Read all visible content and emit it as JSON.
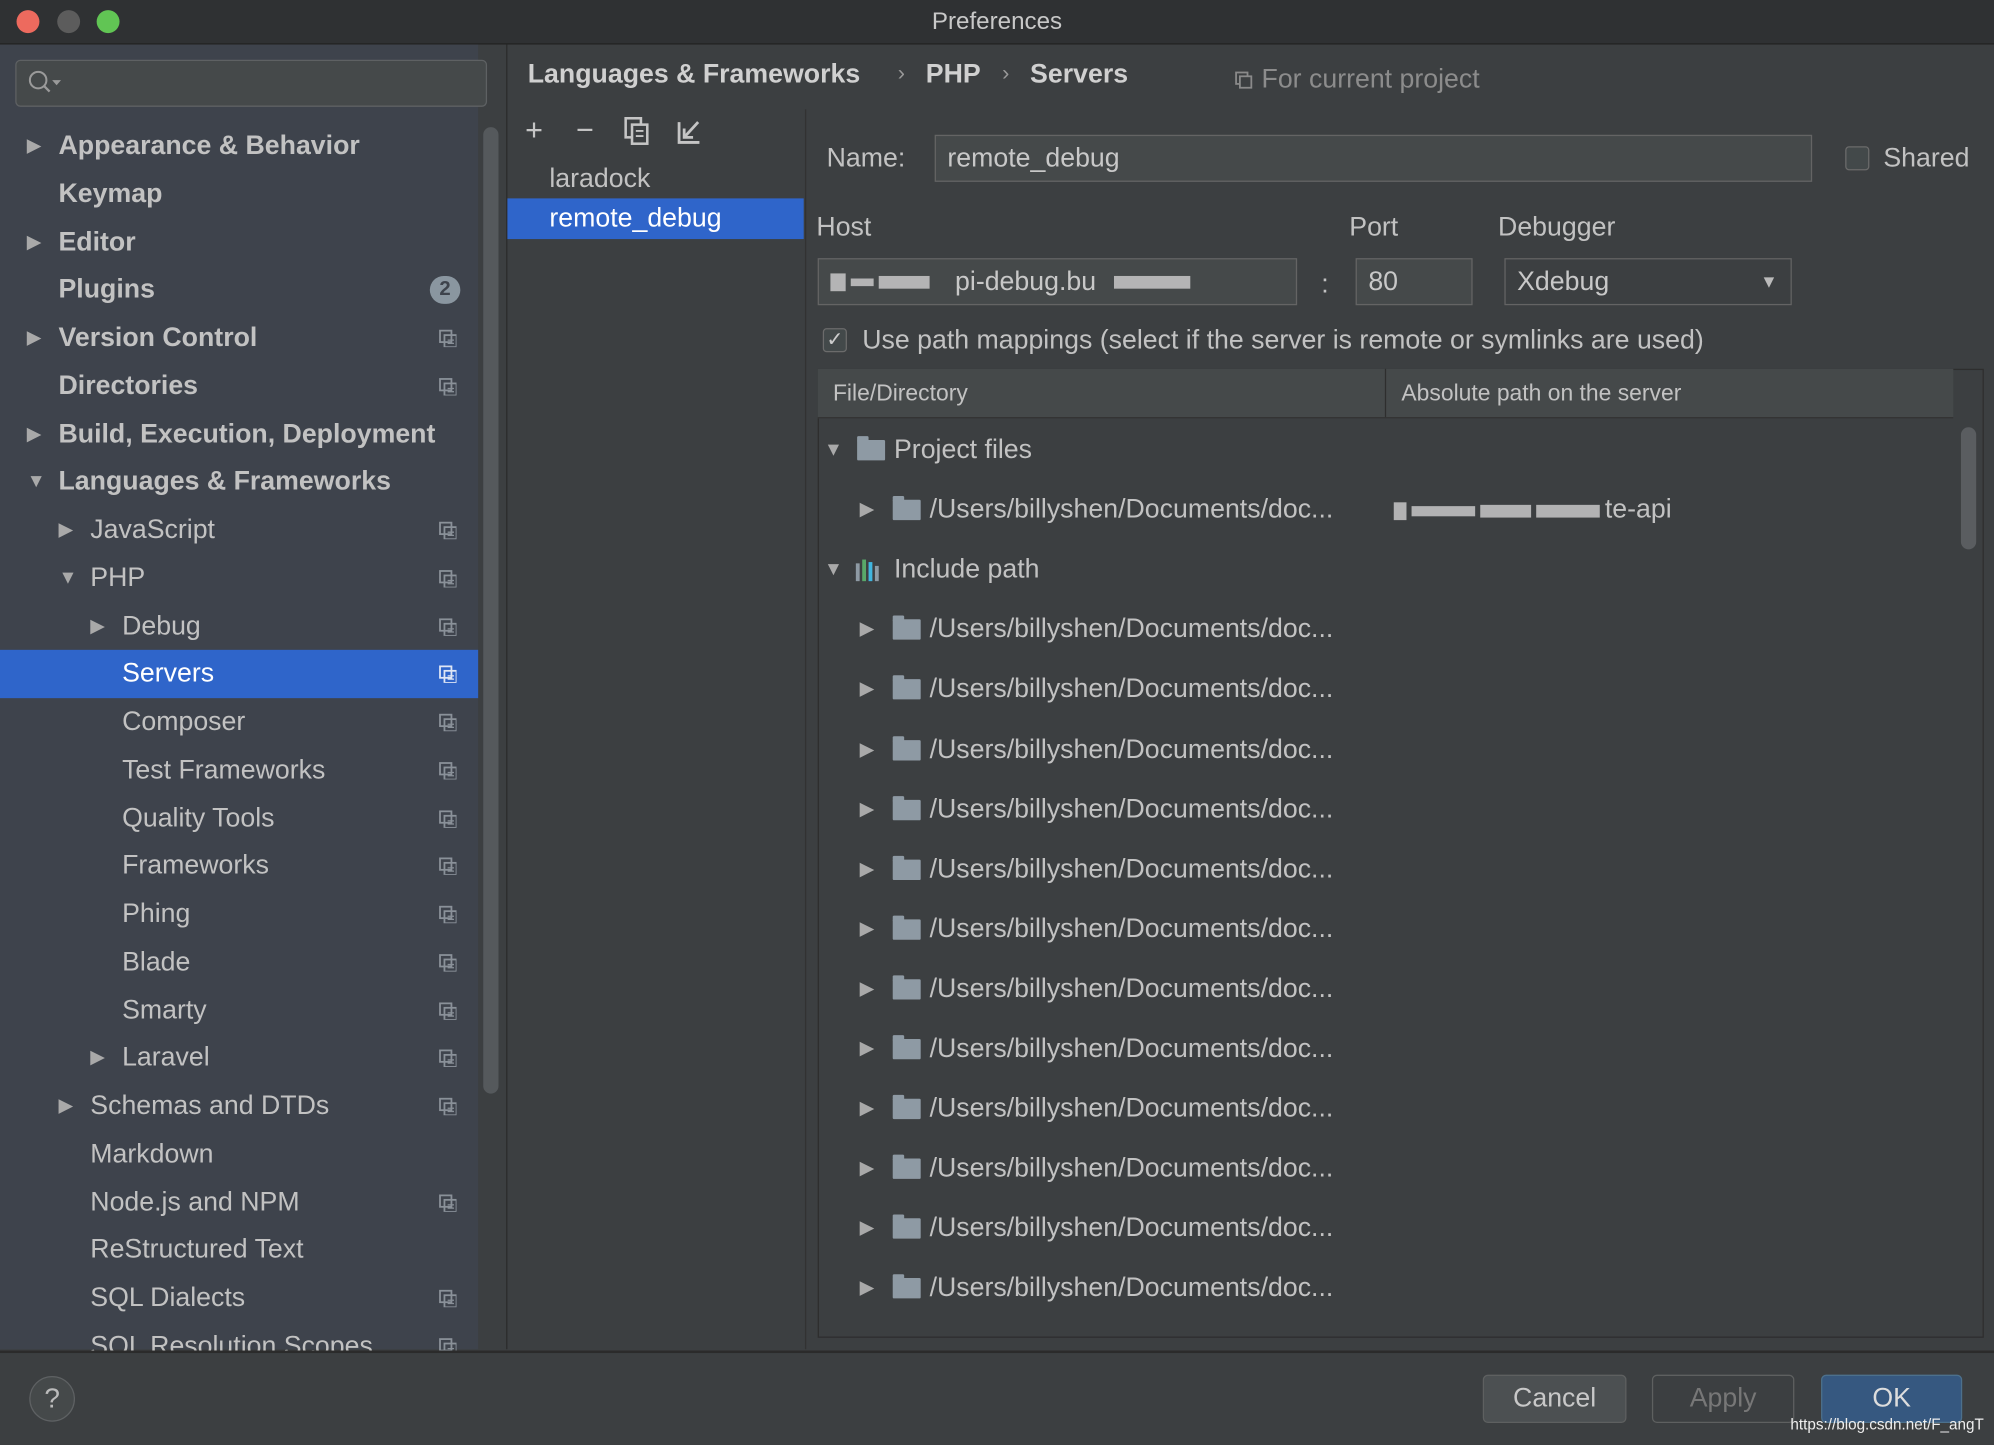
{
  "window": {
    "title": "Preferences",
    "lights": {
      "close": "#ed6a5e",
      "minimize": "#5c5c5c",
      "zoom": "#61c554"
    }
  },
  "sidebar": {
    "search": {
      "placeholder": "",
      "icon": "search-icon"
    },
    "items": [
      {
        "label": "Appearance & Behavior",
        "level": 0,
        "arrow": "collapsed",
        "bold": true
      },
      {
        "label": "Keymap",
        "level": 0,
        "arrow": "none",
        "bold": true
      },
      {
        "label": "Editor",
        "level": 0,
        "arrow": "collapsed",
        "bold": true
      },
      {
        "label": "Plugins",
        "level": 0,
        "arrow": "none",
        "bold": true,
        "badge": "2"
      },
      {
        "label": "Version Control",
        "level": 0,
        "arrow": "collapsed",
        "bold": true,
        "project": true
      },
      {
        "label": "Directories",
        "level": 0,
        "arrow": "none",
        "bold": true,
        "project": true
      },
      {
        "label": "Build, Execution, Deployment",
        "level": 0,
        "arrow": "collapsed",
        "bold": true
      },
      {
        "label": "Languages & Frameworks",
        "level": 0,
        "arrow": "expanded",
        "bold": true
      },
      {
        "label": "JavaScript",
        "level": 1,
        "arrow": "collapsed",
        "project": true
      },
      {
        "label": "PHP",
        "level": 1,
        "arrow": "expanded",
        "project": true
      },
      {
        "label": "Debug",
        "level": 2,
        "arrow": "collapsed",
        "project": true
      },
      {
        "label": "Servers",
        "level": 2,
        "arrow": "none",
        "project": true,
        "selected": true
      },
      {
        "label": "Composer",
        "level": 2,
        "arrow": "none",
        "project": true
      },
      {
        "label": "Test Frameworks",
        "level": 2,
        "arrow": "none",
        "project": true
      },
      {
        "label": "Quality Tools",
        "level": 2,
        "arrow": "none",
        "project": true
      },
      {
        "label": "Frameworks",
        "level": 2,
        "arrow": "none",
        "project": true
      },
      {
        "label": "Phing",
        "level": 2,
        "arrow": "none",
        "project": true
      },
      {
        "label": "Blade",
        "level": 2,
        "arrow": "none",
        "project": true
      },
      {
        "label": "Smarty",
        "level": 2,
        "arrow": "none",
        "project": true
      },
      {
        "label": "Laravel",
        "level": 2,
        "arrow": "collapsed",
        "project": true
      },
      {
        "label": "Schemas and DTDs",
        "level": 1,
        "arrow": "collapsed",
        "project": true
      },
      {
        "label": "Markdown",
        "level": 1,
        "arrow": "none"
      },
      {
        "label": "Node.js and NPM",
        "level": 1,
        "arrow": "none",
        "project": true
      },
      {
        "label": "ReStructured Text",
        "level": 1,
        "arrow": "none"
      },
      {
        "label": "SQL Dialects",
        "level": 1,
        "arrow": "none",
        "project": true
      },
      {
        "label": "SQL Resolution Scopes",
        "level": 1,
        "arrow": "none",
        "project": true
      }
    ]
  },
  "breadcrumb": {
    "items": [
      "Languages & Frameworks",
      "PHP",
      "Servers"
    ],
    "scope": "For current project"
  },
  "servers": {
    "toolbar": [
      "add-icon",
      "remove-icon",
      "copy-icon",
      "import-icon"
    ],
    "items": [
      {
        "label": "laradock"
      },
      {
        "label": "remote_debug",
        "selected": true
      }
    ]
  },
  "form": {
    "name_label": "Name:",
    "name_value": "remote_debug",
    "shared_label": "Shared",
    "shared_checked": false,
    "host_label": "Host",
    "host_value": "pi-debug.bu",
    "port_label": "Port",
    "port_value": "80",
    "colon": ":",
    "debugger_label": "Debugger",
    "debugger_value": "Xdebug",
    "path_mappings_label": "Use path mappings (select if the server is remote or symlinks are used)",
    "path_mappings_checked": true
  },
  "mappings": {
    "columns": [
      "File/Directory",
      "Absolute path on the server"
    ],
    "groups": [
      {
        "label": "Project files",
        "icon": "folder-icon",
        "rows": [
          {
            "path": "/Users/billyshen/Documents/doc...",
            "server": "te-api"
          }
        ]
      },
      {
        "label": "Include path",
        "icon": "library-icon",
        "rows": [
          {
            "path": "/Users/billyshen/Documents/doc..."
          },
          {
            "path": "/Users/billyshen/Documents/doc..."
          },
          {
            "path": "/Users/billyshen/Documents/doc..."
          },
          {
            "path": "/Users/billyshen/Documents/doc..."
          },
          {
            "path": "/Users/billyshen/Documents/doc..."
          },
          {
            "path": "/Users/billyshen/Documents/doc..."
          },
          {
            "path": "/Users/billyshen/Documents/doc..."
          },
          {
            "path": "/Users/billyshen/Documents/doc..."
          },
          {
            "path": "/Users/billyshen/Documents/doc..."
          },
          {
            "path": "/Users/billyshen/Documents/doc..."
          },
          {
            "path": "/Users/billyshen/Documents/doc..."
          },
          {
            "path": "/Users/billyshen/Documents/doc..."
          }
        ]
      }
    ]
  },
  "footer": {
    "help": "?",
    "cancel": "Cancel",
    "apply": "Apply",
    "ok": "OK",
    "watermark": "https://blog.csdn.net/F_angT"
  },
  "colors": {
    "selection": "#2f65ca",
    "ok_button": "#365880"
  }
}
